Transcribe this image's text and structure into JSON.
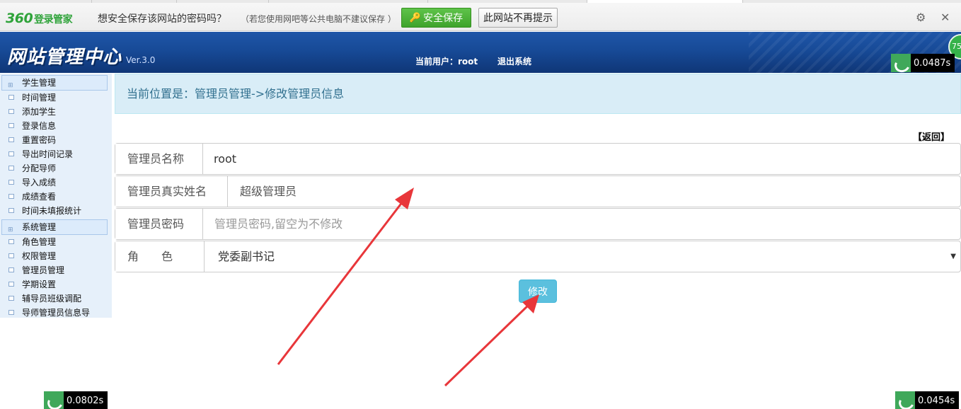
{
  "password_bar": {
    "brand_num": "360",
    "brand_text": "登录管家",
    "question": "想安全保存该网站的密码吗？",
    "hint": "（若您使用网吧等公共电脑不建议保存 ）",
    "save_label": "安全保存",
    "never_label": "此网站不再提示",
    "settings_icon": "gear-icon",
    "close_icon": "close-icon"
  },
  "header": {
    "title": "网站管理中心",
    "version": "Ver.3.0",
    "current_user": "当前用户：root",
    "logout": "退出系统",
    "badge": "75"
  },
  "timers": {
    "top_right": "0.0487s",
    "bottom_left": "0.0802s",
    "bottom_right": "0.0454s"
  },
  "sidebar": {
    "groups": [
      {
        "title": "学生管理",
        "items": [
          "时间管理",
          "添加学生",
          "登录信息",
          "重置密码",
          "导出时间记录",
          "分配导师",
          "导入成绩",
          "成绩查看",
          "时间未填报统计"
        ]
      },
      {
        "title": "系统管理",
        "items": [
          "角色管理",
          "权限管理",
          "管理员管理",
          "学期设置",
          "辅导员班级调配",
          "导师管理员信息导"
        ]
      }
    ]
  },
  "location": "当前位置是：管理员管理->修改管理员信息",
  "back_link": "【返回】",
  "form": {
    "name_label": "管理员名称",
    "name_value": "root",
    "realname_label": "管理员真实姓名",
    "realname_value": "超级管理员",
    "password_label": "管理员密码",
    "password_placeholder": "管理员密码,留空为不修改",
    "role_label": "角　　色",
    "role_value": "党委副书记",
    "submit_label": "修改"
  },
  "colors": {
    "accent_green": "#3ea32b",
    "header_blue": "#174a97",
    "info_bg": "#d9edf7",
    "info_text": "#31708f",
    "button_info": "#5bc0de",
    "arrow_red": "#e8363a"
  }
}
